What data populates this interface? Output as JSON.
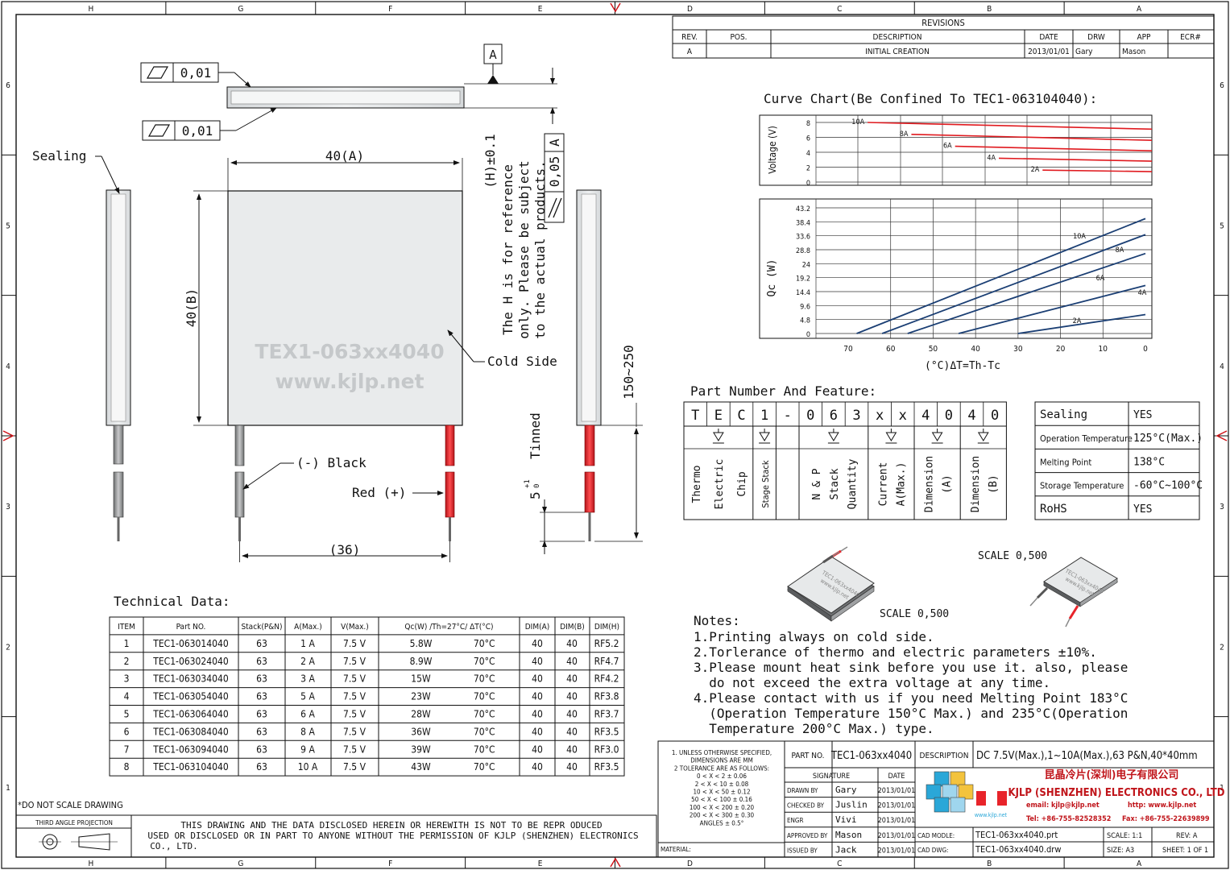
{
  "frame": {
    "cols": [
      "H",
      "G",
      "F",
      "E",
      "D",
      "C",
      "B",
      "A"
    ],
    "rows": [
      "6",
      "5",
      "4",
      "3",
      "2",
      "1"
    ]
  },
  "revisions": {
    "title": "REVISIONS",
    "headers": [
      "REV.",
      "POS.",
      "DESCRIPTION",
      "DATE",
      "DRW",
      "APP",
      "ECR#"
    ],
    "row": [
      "A",
      "",
      "INITIAL CREATION",
      "2013/01/01",
      "Gary",
      "Mason",
      ""
    ]
  },
  "drawing": {
    "flatness1": "0,01",
    "flatness2": "0,01",
    "datum": "A",
    "parallel": "0,05",
    "parallel_ref": "A",
    "sealing": "Sealing",
    "dim_width": "40(A)",
    "dim_height": "40(B)",
    "watermark1": "TEX1-063xx4040",
    "watermark2": "www.kjlp.net",
    "cold_side": "Cold Side",
    "black": "(-) Black",
    "red": "Red (+)",
    "dim_lead_pitch": "(36)",
    "h_note": [
      "(H)±0.1",
      "The H is for reference",
      "only. Please be subject",
      "to the actual products."
    ],
    "tinned": "Tinned",
    "tinned_len": "5",
    "tinned_tol_plus": "+1",
    "tinned_tol_minus": "0",
    "lead_length": "150~250"
  },
  "curve_title": "Curve Chart(Be Confined To TEC1-063104040):",
  "chart_data": [
    {
      "type": "line",
      "ylabel": "Voltage (V)",
      "yticks": [
        "8",
        "6",
        "4",
        "2",
        "0"
      ],
      "ylim": [
        0,
        8
      ],
      "series": [
        {
          "name": "10A",
          "points": [
            [
              65,
              8.0
            ],
            [
              0,
              7.1
            ]
          ]
        },
        {
          "name": "8A",
          "points": [
            [
              55,
              6.4
            ],
            [
              0,
              5.6
            ]
          ]
        },
        {
          "name": "6A",
          "points": [
            [
              45,
              4.8
            ],
            [
              0,
              4.2
            ]
          ]
        },
        {
          "name": "4A",
          "points": [
            [
              35,
              3.2
            ],
            [
              0,
              2.8
            ]
          ]
        },
        {
          "name": "2A",
          "points": [
            [
              25,
              1.6
            ],
            [
              0,
              1.4
            ]
          ]
        }
      ]
    },
    {
      "type": "line",
      "ylabel": "Qc (W)",
      "xlabel": "(°C)ΔT=Th-Tc",
      "xlim": [
        70,
        0
      ],
      "ylim": [
        0,
        43.2
      ],
      "xticks": [
        "70",
        "60",
        "50",
        "40",
        "30",
        "20",
        "10",
        "0"
      ],
      "yticks": [
        "43.2",
        "38.4",
        "33.6",
        "28.8",
        "24",
        "19.2",
        "14.4",
        "9.6",
        "4.8",
        "0"
      ],
      "series": [
        {
          "name": "10A",
          "points": [
            [
              68,
              0
            ],
            [
              0,
              39.5
            ]
          ]
        },
        {
          "name": "8A",
          "points": [
            [
              62,
              0
            ],
            [
              0,
              34
            ]
          ]
        },
        {
          "name": "6A",
          "points": [
            [
              56,
              0
            ],
            [
              0,
              27.5
            ]
          ]
        },
        {
          "name": "4A",
          "points": [
            [
              44,
              0
            ],
            [
              0,
              16.5
            ]
          ]
        },
        {
          "name": "2A",
          "points": [
            [
              30,
              0
            ],
            [
              0,
              6.5
            ]
          ]
        }
      ]
    }
  ],
  "part_number": {
    "title": "Part Number And Feature:",
    "chars": [
      "T",
      "E",
      "C",
      "1",
      "-",
      "0",
      "6",
      "3",
      "x",
      "x",
      "4",
      "0",
      "4",
      "0"
    ],
    "meanings": [
      [
        "Thermo",
        "Electric",
        "Chip"
      ],
      [
        "Stage Stack"
      ],
      [
        "N & P",
        "Stack",
        "Quantity"
      ],
      [
        "Current",
        "A(Max.)"
      ],
      [
        "Dimension",
        "(A)"
      ],
      [
        "Dimension",
        "(B)"
      ]
    ]
  },
  "features": [
    [
      "Sealing",
      "YES"
    ],
    [
      "Operation Temperature",
      "125°C(Max.)"
    ],
    [
      "Melting Point",
      "138°C"
    ],
    [
      "Storage Temperature",
      "-60°C~100°C"
    ],
    [
      "RoHS",
      "YES"
    ]
  ],
  "scale1": "SCALE  0,500",
  "scale2": "SCALE  0,500",
  "notes": {
    "title": "Notes:",
    "lines": [
      "1.Printing always on cold side.",
      "2.Torlerance of thermo and electric parameters ±10%.",
      "3.Please mount heat sink before you use it. also, please",
      "  do not exceed the extra voltage at any time.",
      "4.Please contact with us if you need Melting Point 183°C",
      "  (Operation Temperature 150°C Max.) and 235°C(Operation",
      "  Temperature 200°C Max.) type."
    ]
  },
  "tech": {
    "title": "Technical Data:",
    "headers": [
      "ITEM",
      "Part NO.",
      "Stack(P&N)",
      "A(Max.)",
      "V(Max.)",
      "Qc(W) /Th=27°C/ ΔT(°C)",
      "DIM(A)",
      "DIM(B)",
      "DIM(H)"
    ],
    "rows": [
      [
        "1",
        "TEC1-063014040",
        "63",
        "1 A",
        "7.5 V",
        "5.8W",
        "70°C",
        "40",
        "40",
        "RF5.2"
      ],
      [
        "2",
        "TEC1-063024040",
        "63",
        "2 A",
        "7.5 V",
        "8.9W",
        "70°C",
        "40",
        "40",
        "RF4.7"
      ],
      [
        "3",
        "TEC1-063034040",
        "63",
        "3 A",
        "7.5 V",
        "15W",
        "70°C",
        "40",
        "40",
        "RF4.2"
      ],
      [
        "4",
        "TEC1-063054040",
        "63",
        "5 A",
        "7.5 V",
        "23W",
        "70°C",
        "40",
        "40",
        "RF3.8"
      ],
      [
        "5",
        "TEC1-063064040",
        "63",
        "6 A",
        "7.5 V",
        "28W",
        "70°C",
        "40",
        "40",
        "RF3.7"
      ],
      [
        "6",
        "TEC1-063084040",
        "63",
        "8 A",
        "7.5 V",
        "36W",
        "70°C",
        "40",
        "40",
        "RF3.5"
      ],
      [
        "7",
        "TEC1-063094040",
        "63",
        "9 A",
        "7.5 V",
        "39W",
        "70°C",
        "40",
        "40",
        "RF3.0"
      ],
      [
        "8",
        "TEC1-063104040",
        "63",
        "10 A",
        "7.5 V",
        "43W",
        "70°C",
        "40",
        "40",
        "RF3.5"
      ]
    ]
  },
  "footer": {
    "noscale": "*DO NOT SCALE DRAWING",
    "projection": "THIRD ANGLE PROJECTION",
    "disclaimer": [
      "THIS DRAWING AND THE DATA DISCLOSED HEREIN OR HEREWITH IS NOT TO BE REPR ODUCED",
      "USED OR DISCLOSED OR IN PART TO ANYONE WITHOUT THE PERMISSION OF KJLP (SHENZHEN) ELECTRONICS",
      "CO., LTD."
    ]
  },
  "titleblock": {
    "tolerance": [
      "1. UNLESS OTHERWISE SPECIFIED,",
      "DIMENSIONS ARE MM",
      "2 TOLERANCE ARE AS FOLLOWS:",
      "0 < X < 2  ± 0.06",
      "2 < X < 10  ± 0.08",
      "10 < X < 50  ± 0.12",
      "50 < X < 100  ± 0.16",
      "100 < X < 200  ± 0.20",
      "200 < X < 300  ± 0.30",
      "ANGLES ± 0.5°"
    ],
    "material": "MATERIAL:",
    "part_no_label": "PART NO.",
    "part_no": "TEC1-063xx4040",
    "desc_label": "DESCRIPTION",
    "desc": "DC 7.5V(Max.),1~10A(Max.),63 P&N,40*40mm",
    "sig_header": [
      "SIGNATURE",
      "DATE"
    ],
    "sigs": [
      [
        "DRAWN BY",
        "Gary",
        "2013/01/01"
      ],
      [
        "CHECKED BY",
        "Juslin",
        "2013/01/01"
      ],
      [
        "ENGR",
        "Vivi",
        "2013/01/01"
      ],
      [
        "APPROVED BY",
        "Mason",
        "2013/01/01"
      ],
      [
        "ISSUED BY",
        "Jack",
        "2013/01/01"
      ]
    ],
    "company_cn": "昆晶冷片(深圳)电子有限公司",
    "company_en": "KJLP (SHENZHEN) ELECTRONICS CO., LTD",
    "email": "email: kjlp@kjlp.net",
    "web": "http: www.kjlp.net",
    "tel": "Tel: +86-755-82528352",
    "fax": "Fax: +86-755-22639899",
    "logo_url": "www.kjlp.net",
    "cad_model_label": "CAD MODLE:",
    "cad_model": "TEC1-063xx4040.prt",
    "cad_dwg_label": "CAD DWG:",
    "cad_dwg": "TEC1-063xx4040.drw",
    "scale": "SCALE: 1:1",
    "size": "SIZE: A3",
    "rev": "REV: A",
    "sheet": "SHEET: 1 OF 1"
  },
  "colors": {
    "wire_red": "#e8242a",
    "chart_line": "#e01a1f",
    "blue": "#1b3f74",
    "plate": "#e9ebec"
  }
}
